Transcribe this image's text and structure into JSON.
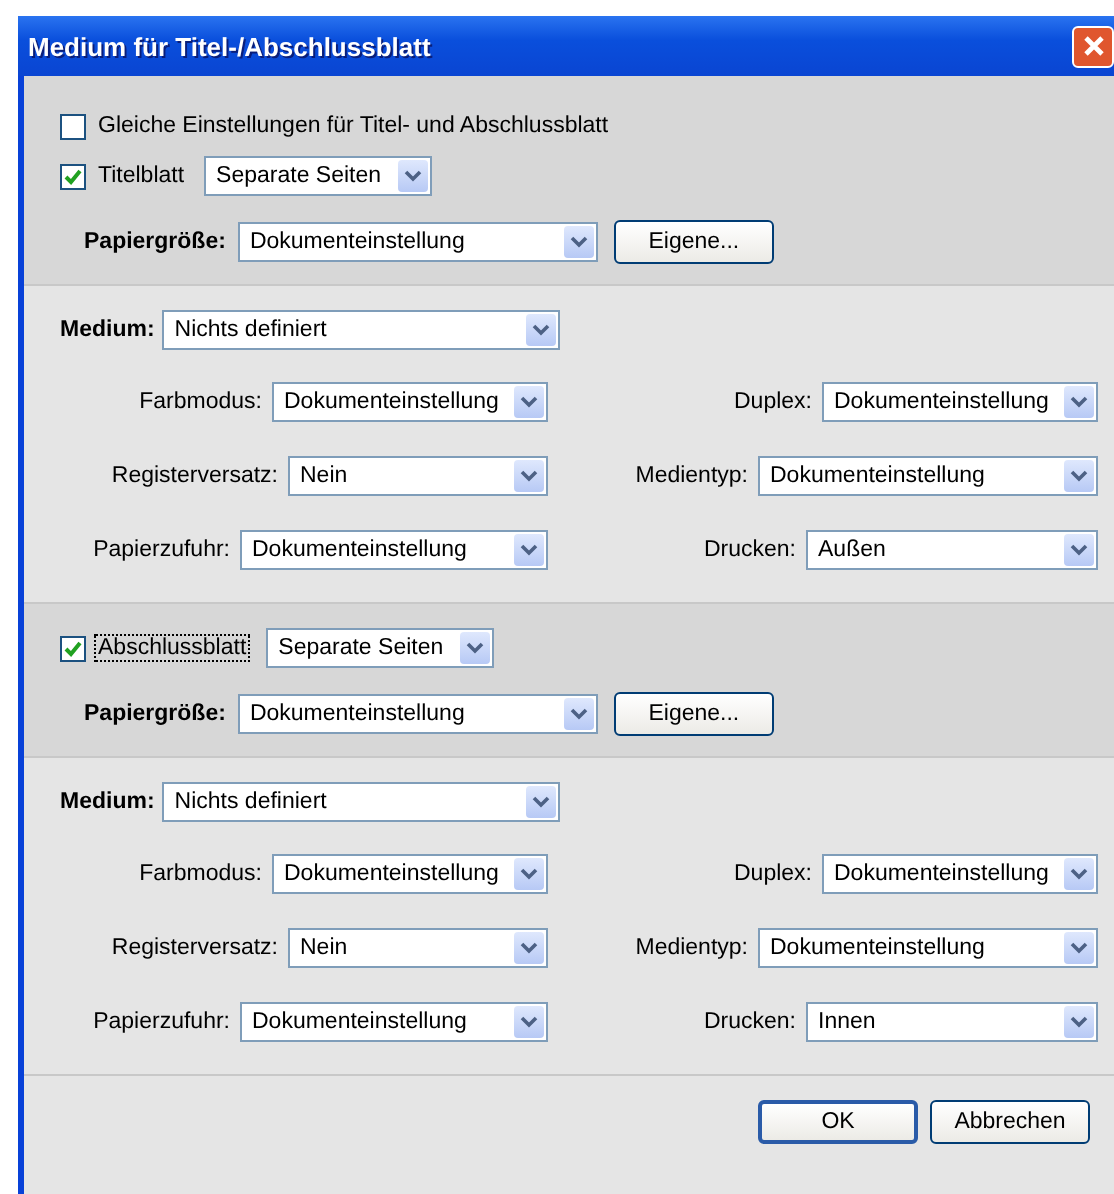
{
  "window": {
    "title": "Medium für Titel-/Abschlussblatt"
  },
  "same_settings": {
    "label": "Gleiche Einstellungen für Titel- und Abschlussblatt",
    "checked": false
  },
  "sections": [
    {
      "label": "Titelblatt",
      "checked": true,
      "focused": false,
      "mode": "Separate Seiten",
      "paper_size": {
        "label": "Papiergröße:",
        "value": "Dokumenteinstellung",
        "button": "Eigene..."
      },
      "medium": {
        "label": "Medium:",
        "value": "Nichts definiert"
      },
      "fields": [
        {
          "label": "Farbmodus:",
          "value": "Dokumenteinstellung"
        },
        {
          "label": "Duplex:",
          "value": "Dokumenteinstellung"
        },
        {
          "label": "Registerversatz:",
          "value": "Nein"
        },
        {
          "label": "Medientyp:",
          "value": "Dokumenteinstellung"
        },
        {
          "label": "Papierzufuhr:",
          "value": "Dokumenteinstellung"
        },
        {
          "label": "Drucken:",
          "value": "Außen"
        }
      ]
    },
    {
      "label": "Abschlussblatt",
      "checked": true,
      "focused": true,
      "mode": "Separate Seiten",
      "paper_size": {
        "label": "Papiergröße:",
        "value": "Dokumenteinstellung",
        "button": "Eigene..."
      },
      "medium": {
        "label": "Medium:",
        "value": "Nichts definiert"
      },
      "fields": [
        {
          "label": "Farbmodus:",
          "value": "Dokumenteinstellung"
        },
        {
          "label": "Duplex:",
          "value": "Dokumenteinstellung"
        },
        {
          "label": "Registerversatz:",
          "value": "Nein"
        },
        {
          "label": "Medientyp:",
          "value": "Dokumenteinstellung"
        },
        {
          "label": "Papierzufuhr:",
          "value": "Dokumenteinstellung"
        },
        {
          "label": "Drucken:",
          "value": "Innen"
        }
      ]
    }
  ],
  "buttons": [
    {
      "label": "OK",
      "default": true
    },
    {
      "label": "Abbrechen",
      "default": false
    }
  ]
}
